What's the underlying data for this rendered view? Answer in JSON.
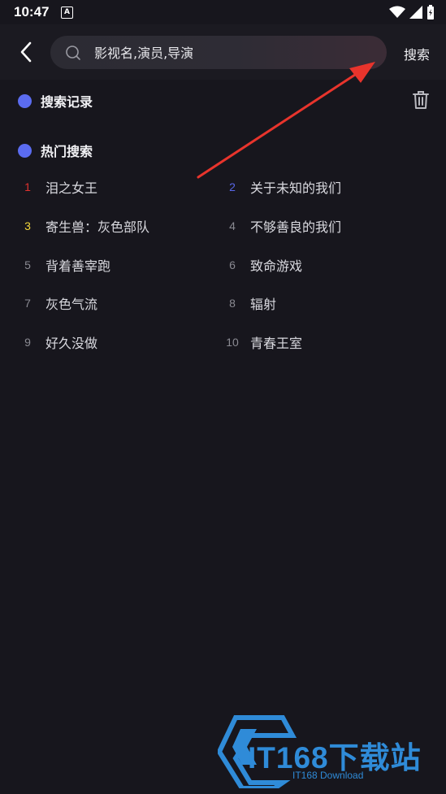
{
  "status_bar": {
    "time": "10:47",
    "notification_badge": "A"
  },
  "search": {
    "placeholder": "影视名,演员,导演",
    "button_label": "搜索"
  },
  "history": {
    "title": "搜索记录"
  },
  "hot": {
    "title": "热门搜索",
    "items": [
      {
        "rank": "1",
        "term": "泪之女王",
        "rank_color": "#e0322e"
      },
      {
        "rank": "2",
        "term": "关于未知的我们",
        "rank_color": "#5866e6"
      },
      {
        "rank": "3",
        "term": "寄生兽：灰色部队",
        "rank_color": "#f2d53a"
      },
      {
        "rank": "4",
        "term": "不够善良的我们",
        "rank_color": "#8a8a92"
      },
      {
        "rank": "5",
        "term": "背着善宰跑",
        "rank_color": "#8a8a92"
      },
      {
        "rank": "6",
        "term": "致命游戏",
        "rank_color": "#8a8a92"
      },
      {
        "rank": "7",
        "term": "灰色气流",
        "rank_color": "#8a8a92"
      },
      {
        "rank": "8",
        "term": "辐射",
        "rank_color": "#8a8a92"
      },
      {
        "rank": "9",
        "term": "好久没做",
        "rank_color": "#8a8a92"
      },
      {
        "rank": "10",
        "term": "青春王室",
        "rank_color": "#8a8a92"
      }
    ]
  },
  "watermark": {
    "brand": "IT168下载站",
    "sub": "IT168 Download"
  },
  "colors": {
    "accent_dot": "#5b6cf0",
    "arrow": "#e8342c",
    "watermark": "#2f8bd8"
  }
}
